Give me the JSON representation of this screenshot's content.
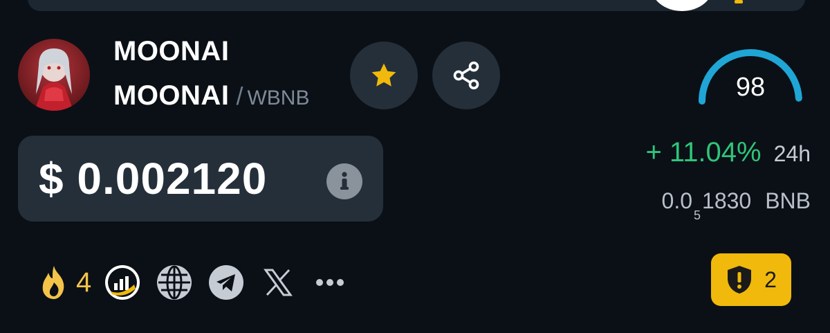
{
  "token": {
    "name": "MOONAI",
    "pair_base": "MOONAI",
    "pair_separator": "/",
    "pair_quote": "WBNB",
    "avatar_icon": "anime-girl-avatar-icon"
  },
  "actions": {
    "favorite_icon": "star-icon",
    "share_icon": "share-icon",
    "favorite_color": "#f0b90b"
  },
  "score": {
    "value": "98",
    "level": 0.98,
    "arc_color": "#1fa6d6"
  },
  "price": {
    "usd": "$ 0.002120",
    "info_icon": "info-icon"
  },
  "change": {
    "value": "+ 11.04%",
    "period": "24h",
    "color": "#2ec57a"
  },
  "bnb_price": {
    "prefix": "0.0",
    "subscript": "5",
    "digits": "1830",
    "unit": "BNB"
  },
  "socials": {
    "fire_count": "4",
    "icons": [
      "fire-icon",
      "chart-logo-icon",
      "globe-icon",
      "telegram-icon",
      "x-icon",
      "more-icon"
    ]
  },
  "audit": {
    "count": "2",
    "icon": "shield-alert-icon",
    "color": "#f0b90b"
  }
}
